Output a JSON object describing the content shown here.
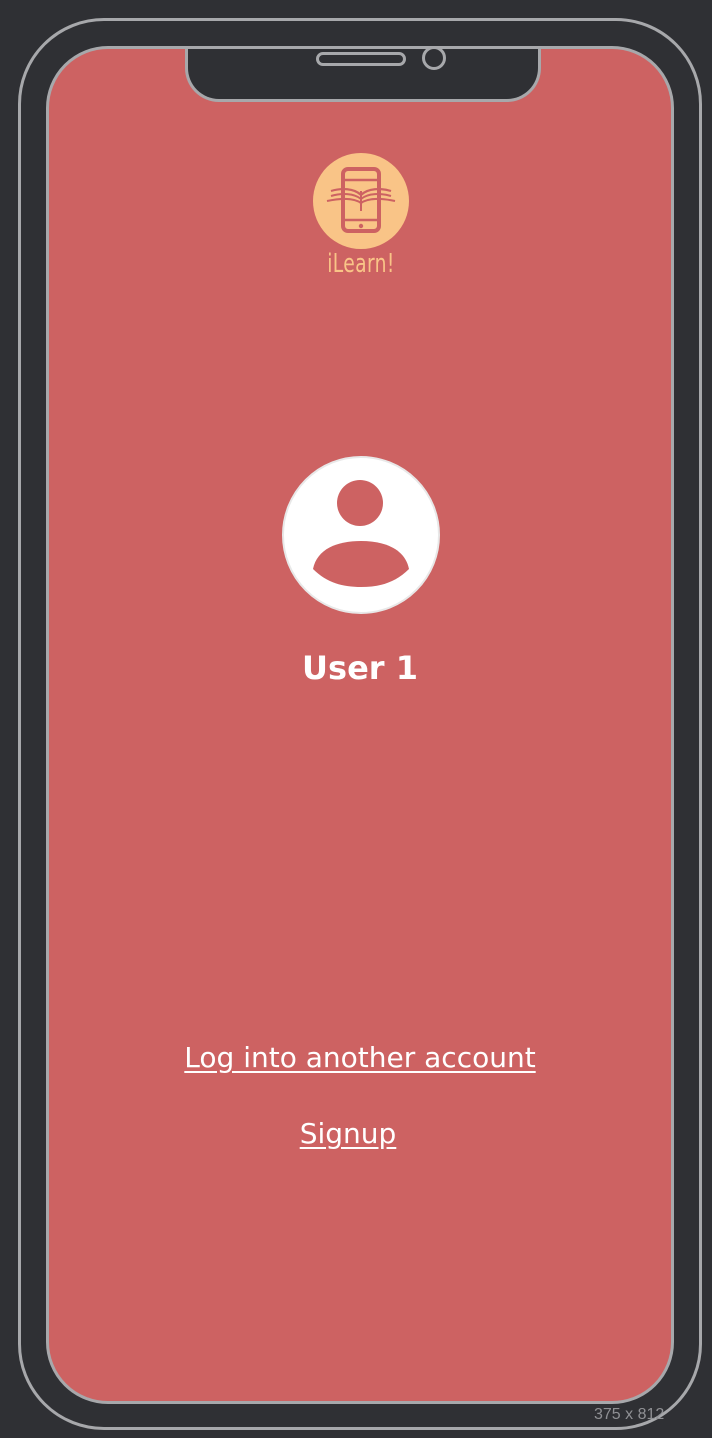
{
  "app": {
    "logo_text": "iLearn!",
    "logo_icon": "phone-book-icon"
  },
  "profile": {
    "avatar_icon": "user-avatar-icon",
    "user_name": "User 1"
  },
  "actions": {
    "login_other": "Log into another account",
    "signup": "Signup"
  },
  "frame": {
    "size_label": "375 x 812"
  },
  "colors": {
    "background": "#cd6262",
    "logo": "#f9c487",
    "frame": "#2f3034",
    "outline": "#a7a8ab",
    "text": "#ffffff"
  }
}
